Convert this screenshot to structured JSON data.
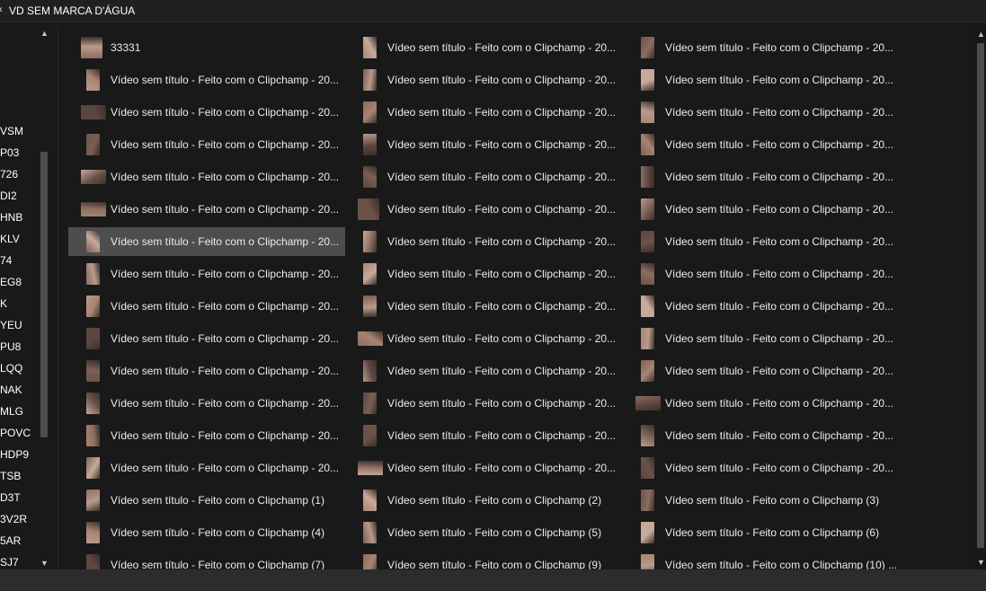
{
  "window": {
    "title": "VD SEM MARCA D'ÁGUA"
  },
  "nav": {
    "items": [
      "VSM",
      "P03",
      "726",
      "DI2",
      "HNB",
      "KLV",
      "74",
      "EG8",
      "K",
      "YEU",
      "PU8",
      "LQQ",
      "NAK",
      "MLG",
      "POVC",
      "HDP9",
      "TSB",
      "D3T",
      "3V2R",
      "5AR",
      "SJ7"
    ]
  },
  "files": [
    [
      "33331",
      "Vídeo sem título - Feito com o Clipchamp - 20...",
      "Vídeo sem título - Feito com o Clipchamp - 20..."
    ],
    [
      "Vídeo sem título - Feito com o Clipchamp - 20...",
      "Vídeo sem título - Feito com o Clipchamp - 20...",
      "Vídeo sem título - Feito com o Clipchamp - 20..."
    ],
    [
      "Vídeo sem título - Feito com o Clipchamp - 20...",
      "Vídeo sem título - Feito com o Clipchamp - 20...",
      "Vídeo sem título - Feito com o Clipchamp - 20..."
    ],
    [
      "Vídeo sem título - Feito com o Clipchamp - 20...",
      "Vídeo sem título - Feito com o Clipchamp - 20...",
      "Vídeo sem título - Feito com o Clipchamp - 20..."
    ],
    [
      "Vídeo sem título - Feito com o Clipchamp - 20...",
      "Vídeo sem título - Feito com o Clipchamp - 20...",
      "Vídeo sem título - Feito com o Clipchamp - 20..."
    ],
    [
      "Vídeo sem título - Feito com o Clipchamp - 20...",
      "Vídeo sem título - Feito com o Clipchamp - 20...",
      "Vídeo sem título - Feito com o Clipchamp - 20..."
    ],
    [
      "Vídeo sem título - Feito com o Clipchamp - 20...",
      "Vídeo sem título - Feito com o Clipchamp - 20...",
      "Vídeo sem título - Feito com o Clipchamp - 20..."
    ],
    [
      "Vídeo sem título - Feito com o Clipchamp - 20...",
      "Vídeo sem título - Feito com o Clipchamp - 20...",
      "Vídeo sem título - Feito com o Clipchamp - 20..."
    ],
    [
      "Vídeo sem título - Feito com o Clipchamp - 20...",
      "Vídeo sem título - Feito com o Clipchamp - 20...",
      "Vídeo sem título - Feito com o Clipchamp - 20..."
    ],
    [
      "Vídeo sem título - Feito com o Clipchamp - 20...",
      "Vídeo sem título - Feito com o Clipchamp - 20...",
      "Vídeo sem título - Feito com o Clipchamp - 20..."
    ],
    [
      "Vídeo sem título - Feito com o Clipchamp - 20...",
      "Vídeo sem título - Feito com o Clipchamp - 20...",
      "Vídeo sem título - Feito com o Clipchamp - 20..."
    ],
    [
      "Vídeo sem título - Feito com o Clipchamp - 20...",
      "Vídeo sem título - Feito com o Clipchamp - 20...",
      "Vídeo sem título - Feito com o Clipchamp - 20..."
    ],
    [
      "Vídeo sem título - Feito com o Clipchamp - 20...",
      "Vídeo sem título - Feito com o Clipchamp - 20...",
      "Vídeo sem título - Feito com o Clipchamp - 20..."
    ],
    [
      "Vídeo sem título - Feito com o Clipchamp - 20...",
      "Vídeo sem título - Feito com o Clipchamp - 20...",
      "Vídeo sem título - Feito com o Clipchamp - 20..."
    ],
    [
      "Vídeo sem título - Feito com o Clipchamp (1)",
      "Vídeo sem título - Feito com o Clipchamp (2)",
      "Vídeo sem título - Feito com o Clipchamp (3)"
    ],
    [
      "Vídeo sem título - Feito com o Clipchamp (4)",
      "Vídeo sem título - Feito com o Clipchamp (5)",
      "Vídeo sem título - Feito com o Clipchamp (6)"
    ],
    [
      "Vídeo sem título - Feito com o Clipchamp (7)",
      "Vídeo sem título - Feito com o Clipchamp (9)",
      "Vídeo sem título - Feito com o Clipchamp (10) ..."
    ]
  ],
  "thumb_shapes": [
    [
      "square",
      "portrait",
      "portrait"
    ],
    [
      "portrait",
      "portrait",
      "portrait"
    ],
    [
      "landscape",
      "portrait",
      "portrait"
    ],
    [
      "portrait",
      "portrait",
      "portrait"
    ],
    [
      "landscape",
      "portrait",
      "portrait"
    ],
    [
      "landscape",
      "square",
      "portrait"
    ],
    [
      "portrait",
      "portrait",
      "portrait"
    ],
    [
      "portrait",
      "portrait",
      "portrait"
    ],
    [
      "portrait",
      "portrait",
      "portrait"
    ],
    [
      "portrait",
      "landscape",
      "portrait"
    ],
    [
      "portrait",
      "portrait",
      "portrait"
    ],
    [
      "portrait",
      "portrait",
      "landscape"
    ],
    [
      "portrait",
      "portrait",
      "portrait"
    ],
    [
      "portrait",
      "landscape",
      "portrait"
    ],
    [
      "portrait",
      "portrait",
      "portrait"
    ],
    [
      "portrait",
      "portrait",
      "portrait"
    ],
    [
      "portrait",
      "portrait",
      "portrait"
    ]
  ],
  "selected": {
    "row": 6,
    "col": 0
  },
  "colors": {
    "background": "#191919",
    "selected": "#4d4d4d",
    "skin_tones": [
      "#8c6d5e",
      "#a88472",
      "#6b5249",
      "#b99a8b",
      "#7a5f54",
      "#c7aa9a",
      "#5c4640"
    ]
  }
}
